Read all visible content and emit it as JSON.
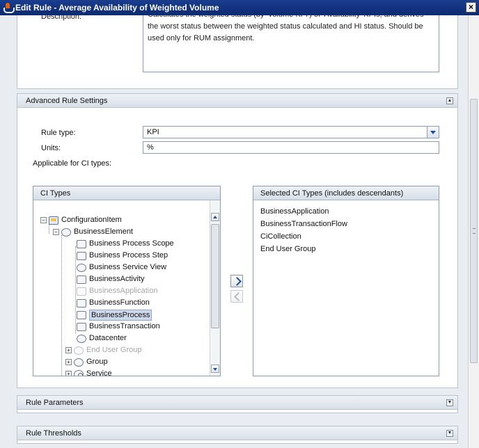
{
  "window": {
    "title": "Edit Rule - Average Availability of Weighted Volume",
    "close_label": "×"
  },
  "description": {
    "label": "Description:",
    "text": "Calculates the weighted status (by 'Volume KPI') of 'Availability' KPIs, and derives the worst status between the weighted status calculated and HI status. Should be used only for RUM assignment."
  },
  "advanced": {
    "header": "Advanced Rule Settings",
    "collapse_icon": "collapse-icon",
    "rule_type_label": "Rule type:",
    "rule_type_value": "KPI",
    "units_label": "Units:",
    "units_value": "%",
    "applicable_label": "Applicable for CI types:",
    "ci_types_header": "CI Types",
    "selected_header": "Selected CI Types (includes descendants)",
    "tree": [
      {
        "label": "ConfigurationItem",
        "icon": "configuration-item-icon"
      },
      {
        "label": "BusinessElement",
        "icon": "business-element-icon"
      },
      {
        "label": "Business Process Scope",
        "icon": "business-process-scope-icon"
      },
      {
        "label": "Business Process Step",
        "icon": "business-process-step-icon"
      },
      {
        "label": "Business Service View",
        "icon": "business-service-view-icon"
      },
      {
        "label": "BusinessActivity",
        "icon": "business-activity-icon"
      },
      {
        "label": "BusinessApplication",
        "icon": "business-application-icon"
      },
      {
        "label": "BusinessFunction",
        "icon": "business-function-icon"
      },
      {
        "label": "BusinessProcess",
        "icon": "business-process-icon"
      },
      {
        "label": "BusinessTransaction",
        "icon": "business-transaction-icon"
      },
      {
        "label": "Datacenter",
        "icon": "datacenter-icon"
      },
      {
        "label": "End User Group",
        "icon": "end-user-group-icon"
      },
      {
        "label": "Group",
        "icon": "group-icon"
      },
      {
        "label": "Service",
        "icon": "service-icon"
      }
    ],
    "selected_items": [
      "BusinessApplication",
      "BusinessTransactionFlow",
      "CiCollection",
      "End User Group"
    ]
  },
  "rule_parameters": {
    "header": "Rule Parameters",
    "expand_icon": "expand-icon"
  },
  "rule_thresholds": {
    "header": "Rule Thresholds",
    "expand_icon": "expand-icon"
  }
}
